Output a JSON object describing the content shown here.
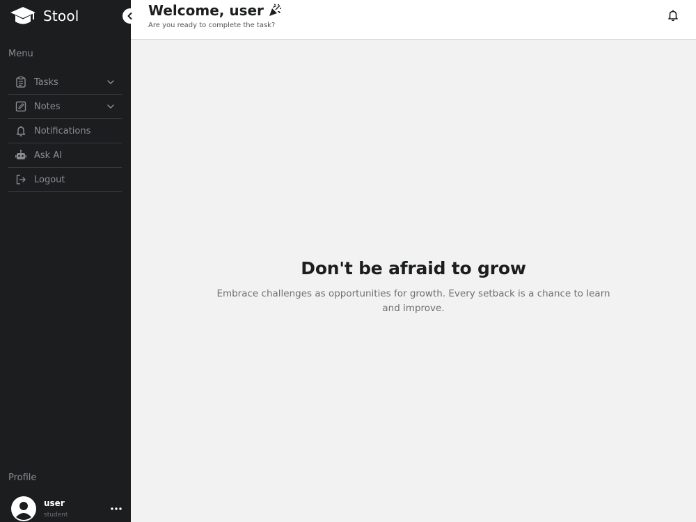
{
  "brand": {
    "name": "Stool"
  },
  "sidebar": {
    "menu_heading": "Menu",
    "items": [
      {
        "label": "Tasks",
        "icon": "clipboard-icon",
        "has_chevron": true
      },
      {
        "label": "Notes",
        "icon": "note-edit-icon",
        "has_chevron": true
      },
      {
        "label": "Notifications",
        "icon": "bell-icon",
        "has_chevron": false
      },
      {
        "label": "Ask AI",
        "icon": "robot-icon",
        "has_chevron": false
      },
      {
        "label": "Logout",
        "icon": "logout-icon",
        "has_chevron": false
      }
    ],
    "profile_heading": "Profile",
    "profile": {
      "name": "user",
      "role": "student"
    }
  },
  "header": {
    "title": "Welcome, user",
    "subtitle": "Are you ready to complete the task?"
  },
  "main": {
    "hero_title": "Don't be afraid to grow",
    "hero_text": "Embrace challenges as opportunities for growth. Every setback is a chance to learn and improve."
  },
  "colors": {
    "sidebar_bg": "#1c1d1f",
    "content_bg": "#f2f2f2",
    "muted_text": "#8a8c90",
    "heading_text": "#1c1d1f"
  }
}
